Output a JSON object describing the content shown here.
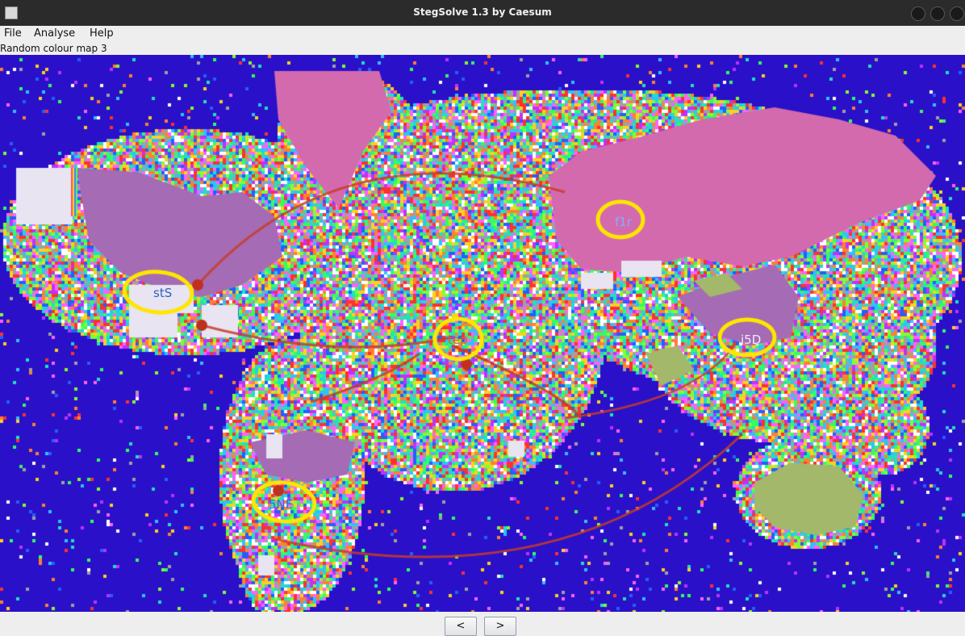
{
  "window": {
    "title": "StegSolve 1.3 by Caesum"
  },
  "menu": {
    "items": [
      "File",
      "Analyse",
      "Help"
    ]
  },
  "view": {
    "mode_label": "Random colour map 3"
  },
  "image_annotations": {
    "texts": [
      "stS",
      "f1r",
      "tep",
      "i5D",
      "5NE"
    ],
    "highlight_color": "#ffe600"
  },
  "nav": {
    "prev_label": "<",
    "next_label": ">"
  },
  "colors": {
    "ocean": "#2a10c8",
    "land_pink": "#d36aae",
    "land_violet": "#a56bb4",
    "land_green": "#a3b86a",
    "land_white": "#e8e4f2"
  }
}
